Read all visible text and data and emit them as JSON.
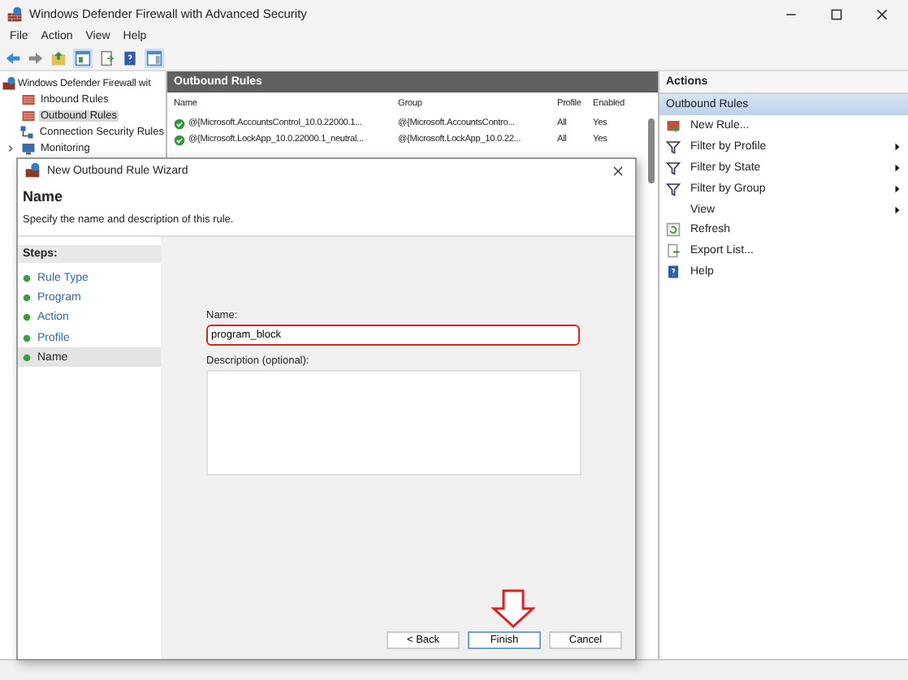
{
  "window": {
    "title": "Windows Defender Firewall with Advanced Security"
  },
  "menu": [
    "File",
    "Action",
    "View",
    "Help"
  ],
  "tree": {
    "label": "Windows Defender Firewall wit",
    "children": [
      {
        "label": "Inbound Rules",
        "kind": "rules",
        "selected": false
      },
      {
        "label": "Outbound Rules",
        "kind": "rules",
        "selected": true
      },
      {
        "label": "Connection Security Rules",
        "kind": "connection",
        "selected": false
      },
      {
        "label": "Monitoring",
        "kind": "monitoring",
        "selected": false,
        "expanded": false
      }
    ]
  },
  "rules": {
    "title": "Outbound Rules",
    "columns": [
      "Name",
      "Group",
      "Profile",
      "Enabled"
    ],
    "rows": [
      {
        "name": "@{Microsoft.AccountsControl_10.0.22000.1...",
        "group": "@{Microsoft.AccountsContro...",
        "profile": "All",
        "enabled": "Yes"
      },
      {
        "name": "@{Microsoft.LockApp_10.0.22000.1_neutral...",
        "group": "@{Microsoft.LockApp_10.0.22...",
        "profile": "All",
        "enabled": "Yes"
      }
    ]
  },
  "actions": {
    "title": "Actions",
    "section": "Outbound Rules",
    "items": [
      {
        "label": "New Rule...",
        "kind": "newrule",
        "submenu": false
      },
      {
        "label": "Filter by Profile",
        "kind": "filter",
        "submenu": true
      },
      {
        "label": "Filter by State",
        "kind": "filter",
        "submenu": true
      },
      {
        "label": "Filter by Group",
        "kind": "filter",
        "submenu": true
      },
      {
        "label": "View",
        "kind": "plain",
        "submenu": true
      },
      {
        "label": "Refresh",
        "kind": "refresh",
        "submenu": false
      },
      {
        "label": "Export List...",
        "kind": "export",
        "submenu": false
      },
      {
        "label": "Help",
        "kind": "help",
        "submenu": false
      }
    ]
  },
  "wizard": {
    "title": "New Outbound Rule Wizard",
    "heading": "Name",
    "subtitle": "Specify the name and description of this rule.",
    "steps_label": "Steps:",
    "steps": [
      {
        "label": "Rule Type",
        "selected": false
      },
      {
        "label": "Program",
        "selected": false
      },
      {
        "label": "Action",
        "selected": false
      },
      {
        "label": "Profile",
        "selected": false
      },
      {
        "label": "Name",
        "selected": true
      }
    ],
    "name_label": "Name:",
    "name_value": "program_block",
    "description_label": "Description (optional):",
    "buttons": [
      {
        "label": "< Back",
        "default": false
      },
      {
        "label": "Finish",
        "default": true
      },
      {
        "label": "Cancel",
        "default": false
      }
    ]
  }
}
